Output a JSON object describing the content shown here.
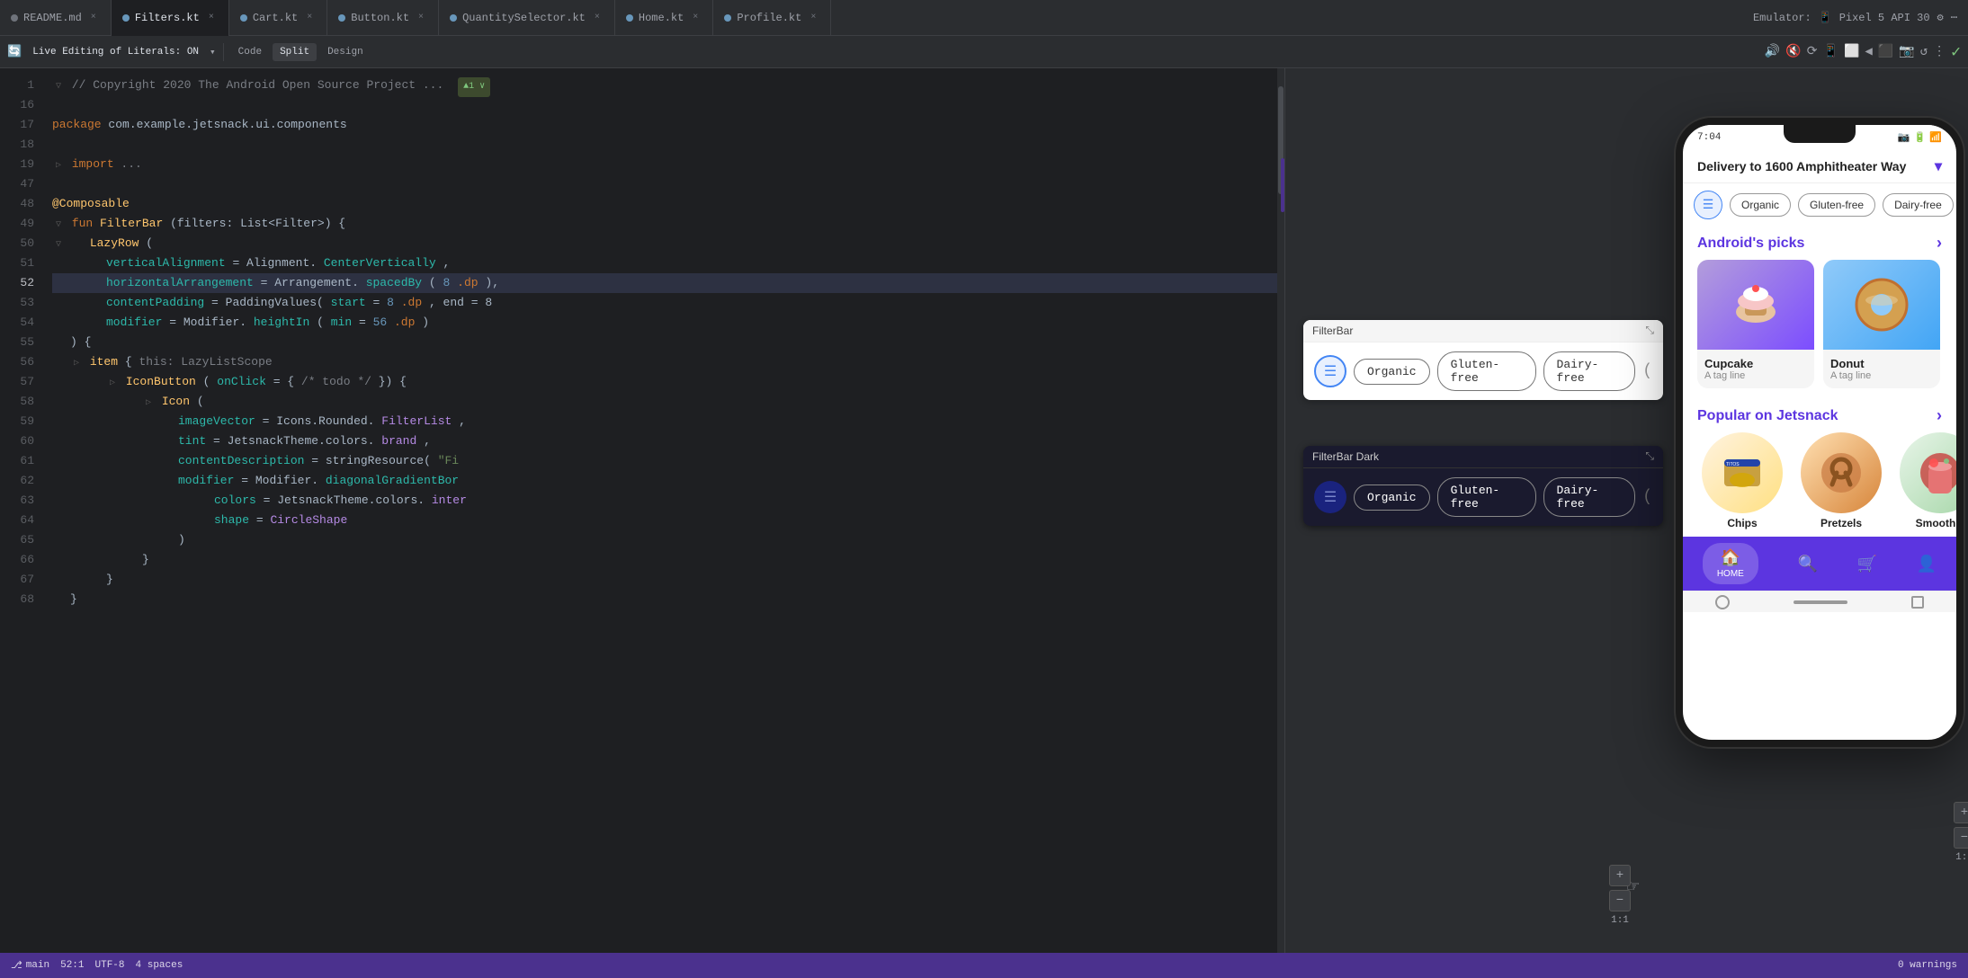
{
  "tabs": [
    {
      "label": "README.md",
      "type": "md",
      "active": false
    },
    {
      "label": "Filters.kt",
      "type": "kt",
      "active": true
    },
    {
      "label": "Cart.kt",
      "type": "kt",
      "active": false
    },
    {
      "label": "Button.kt",
      "type": "kt",
      "active": false
    },
    {
      "label": "QuantitySelector.kt",
      "type": "kt",
      "active": false
    },
    {
      "label": "Home.kt",
      "type": "kt",
      "active": false
    },
    {
      "label": "Profile.kt",
      "type": "kt",
      "active": false
    }
  ],
  "emulator": {
    "label": "Emulator:",
    "device": "Pixel 5 API 30"
  },
  "toolbar": {
    "live_edit": "Live Editing of Literals: ON",
    "code": "Code",
    "split": "Split",
    "design": "Design"
  },
  "code": {
    "lines": [
      {
        "num": 1,
        "text": "// Copyright 2020 The Android Open Source Project ...",
        "badge": "▲1 ∨"
      },
      {
        "num": 16,
        "text": ""
      },
      {
        "num": 17,
        "text": "package com.example.jetsnack.ui.components"
      },
      {
        "num": 18,
        "text": ""
      },
      {
        "num": 19,
        "text": "import ..."
      },
      {
        "num": 47,
        "text": ""
      },
      {
        "num": 48,
        "text": "@Composable"
      },
      {
        "num": 49,
        "text": "fun FilterBar(filters: List<Filter>) {"
      },
      {
        "num": 50,
        "text": "    LazyRow("
      },
      {
        "num": 51,
        "text": "        verticalAlignment = Alignment.CenterVertically,"
      },
      {
        "num": 52,
        "text": "        horizontalArrangement = Arrangement.spacedBy(8.dp),",
        "active": true
      },
      {
        "num": 53,
        "text": "        contentPadding = PaddingValues(start = 8.dp, end = 8"
      },
      {
        "num": 54,
        "text": "        modifier = Modifier.heightIn(min = 56.dp)"
      },
      {
        "num": 55,
        "text": "    ) {"
      },
      {
        "num": 56,
        "text": "        item {"
      },
      {
        "num": 57,
        "text": "            IconButton(onClick = { /* todo */ }) {"
      },
      {
        "num": 58,
        "text": "                Icon("
      },
      {
        "num": 59,
        "text": "                    imageVector = Icons.Rounded.FilterList,"
      },
      {
        "num": 60,
        "text": "                    tint = JetsnackTheme.colors.brand,"
      },
      {
        "num": 61,
        "text": "                    contentDescription = stringResource(\"Fi"
      },
      {
        "num": 62,
        "text": "                    modifier = Modifier.diagonalGradientBor"
      },
      {
        "num": 63,
        "text": "                    colors = JetsnackTheme.colors.inter"
      },
      {
        "num": 64,
        "text": "                    shape = CircleShape"
      },
      {
        "num": 65,
        "text": "                )"
      },
      {
        "num": 66,
        "text": "            }"
      },
      {
        "num": 67,
        "text": "        }"
      },
      {
        "num": 68,
        "text": "    }"
      }
    ]
  },
  "preview_filterbar_light": {
    "title": "FilterBar",
    "chips": [
      "Organic",
      "Gluten-free",
      "Dairy-free"
    ]
  },
  "preview_filterbar_dark": {
    "title": "FilterBar Dark",
    "chips": [
      "Organic",
      "Gluten-free",
      "Dairy-free"
    ]
  },
  "phone": {
    "status_time": "7:04",
    "delivery_text": "Delivery to 1600 Amphitheater Way",
    "filter_chips": [
      "Organic",
      "Gluten-free",
      "Dairy-free"
    ],
    "androids_picks_title": "Android's picks",
    "picks": [
      {
        "name": "Cupcake",
        "tag": "A tag line"
      },
      {
        "name": "Donut",
        "tag": "A tag line"
      }
    ],
    "popular_title": "Popular on Jetsnack",
    "popular": [
      {
        "name": "Chips"
      },
      {
        "name": "Pretzels"
      },
      {
        "name": "Smooth..."
      }
    ],
    "nav": [
      "HOME",
      "search",
      "cart",
      "profile"
    ]
  },
  "colors": {
    "brand": "#5c35e0",
    "active_tab_bg": "#1e1f22",
    "editor_bg": "#1e1f22",
    "sidebar_bg": "#2b2d30"
  }
}
